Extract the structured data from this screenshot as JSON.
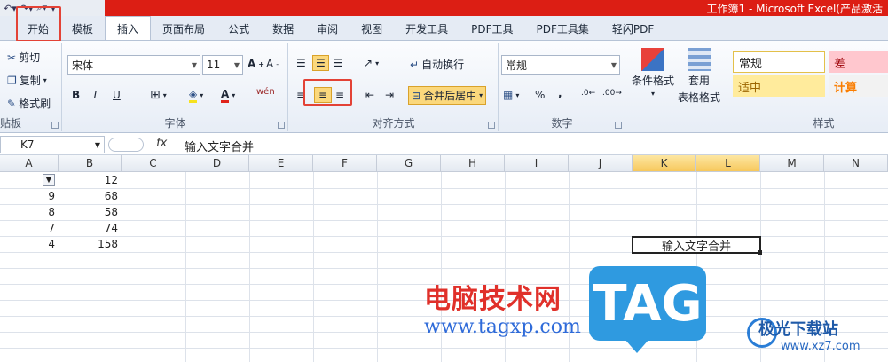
{
  "titlebar": {
    "title": "工作簿1 - Microsoft Excel(产品激活"
  },
  "tabs": [
    "开始",
    "模板",
    "插入",
    "页面布局",
    "公式",
    "数据",
    "审阅",
    "视图",
    "开发工具",
    "PDF工具",
    "PDF工具集",
    "轻闪PDF"
  ],
  "ribbon": {
    "clipboard": {
      "cut": "剪切",
      "copy": "复制",
      "format_painter": "格式刷",
      "label": "贴板"
    },
    "font": {
      "name": "宋体",
      "size": "11",
      "bold": "B",
      "italic": "I",
      "underline": "U",
      "label": "字体"
    },
    "alignment": {
      "wrap": "自动换行",
      "merge": "合并后居中",
      "label": "对齐方式"
    },
    "number": {
      "format": "常规",
      "label": "数字",
      "percent": "%",
      "comma": ","
    },
    "styles": {
      "cond_format": "条件格式",
      "table_format_1": "套用",
      "table_format_2": "表格格式",
      "normal": "常规",
      "bad": "差",
      "neutral": "适中",
      "calc": "计算",
      "label": "样式"
    }
  },
  "formula_bar": {
    "name_box": "K7",
    "fx": "fx",
    "content": "输入文字合并"
  },
  "columns": [
    "A",
    "B",
    "C",
    "D",
    "E",
    "F",
    "G",
    "H",
    "I",
    "J",
    "K",
    "L",
    "M",
    "N"
  ],
  "rows": [
    {
      "a": "",
      "b": "12"
    },
    {
      "a": "9",
      "b": "68"
    },
    {
      "a": "8",
      "b": "58"
    },
    {
      "a": "7",
      "b": "74"
    },
    {
      "a": "4",
      "b": "158"
    }
  ],
  "merged_cell": "输入文字合并",
  "watermark": {
    "cn": "电脑技术网",
    "url": "www.tagxp.com",
    "tag": "TAG",
    "site_cn": "极光下载站",
    "site_url": "www.xz7.com"
  }
}
